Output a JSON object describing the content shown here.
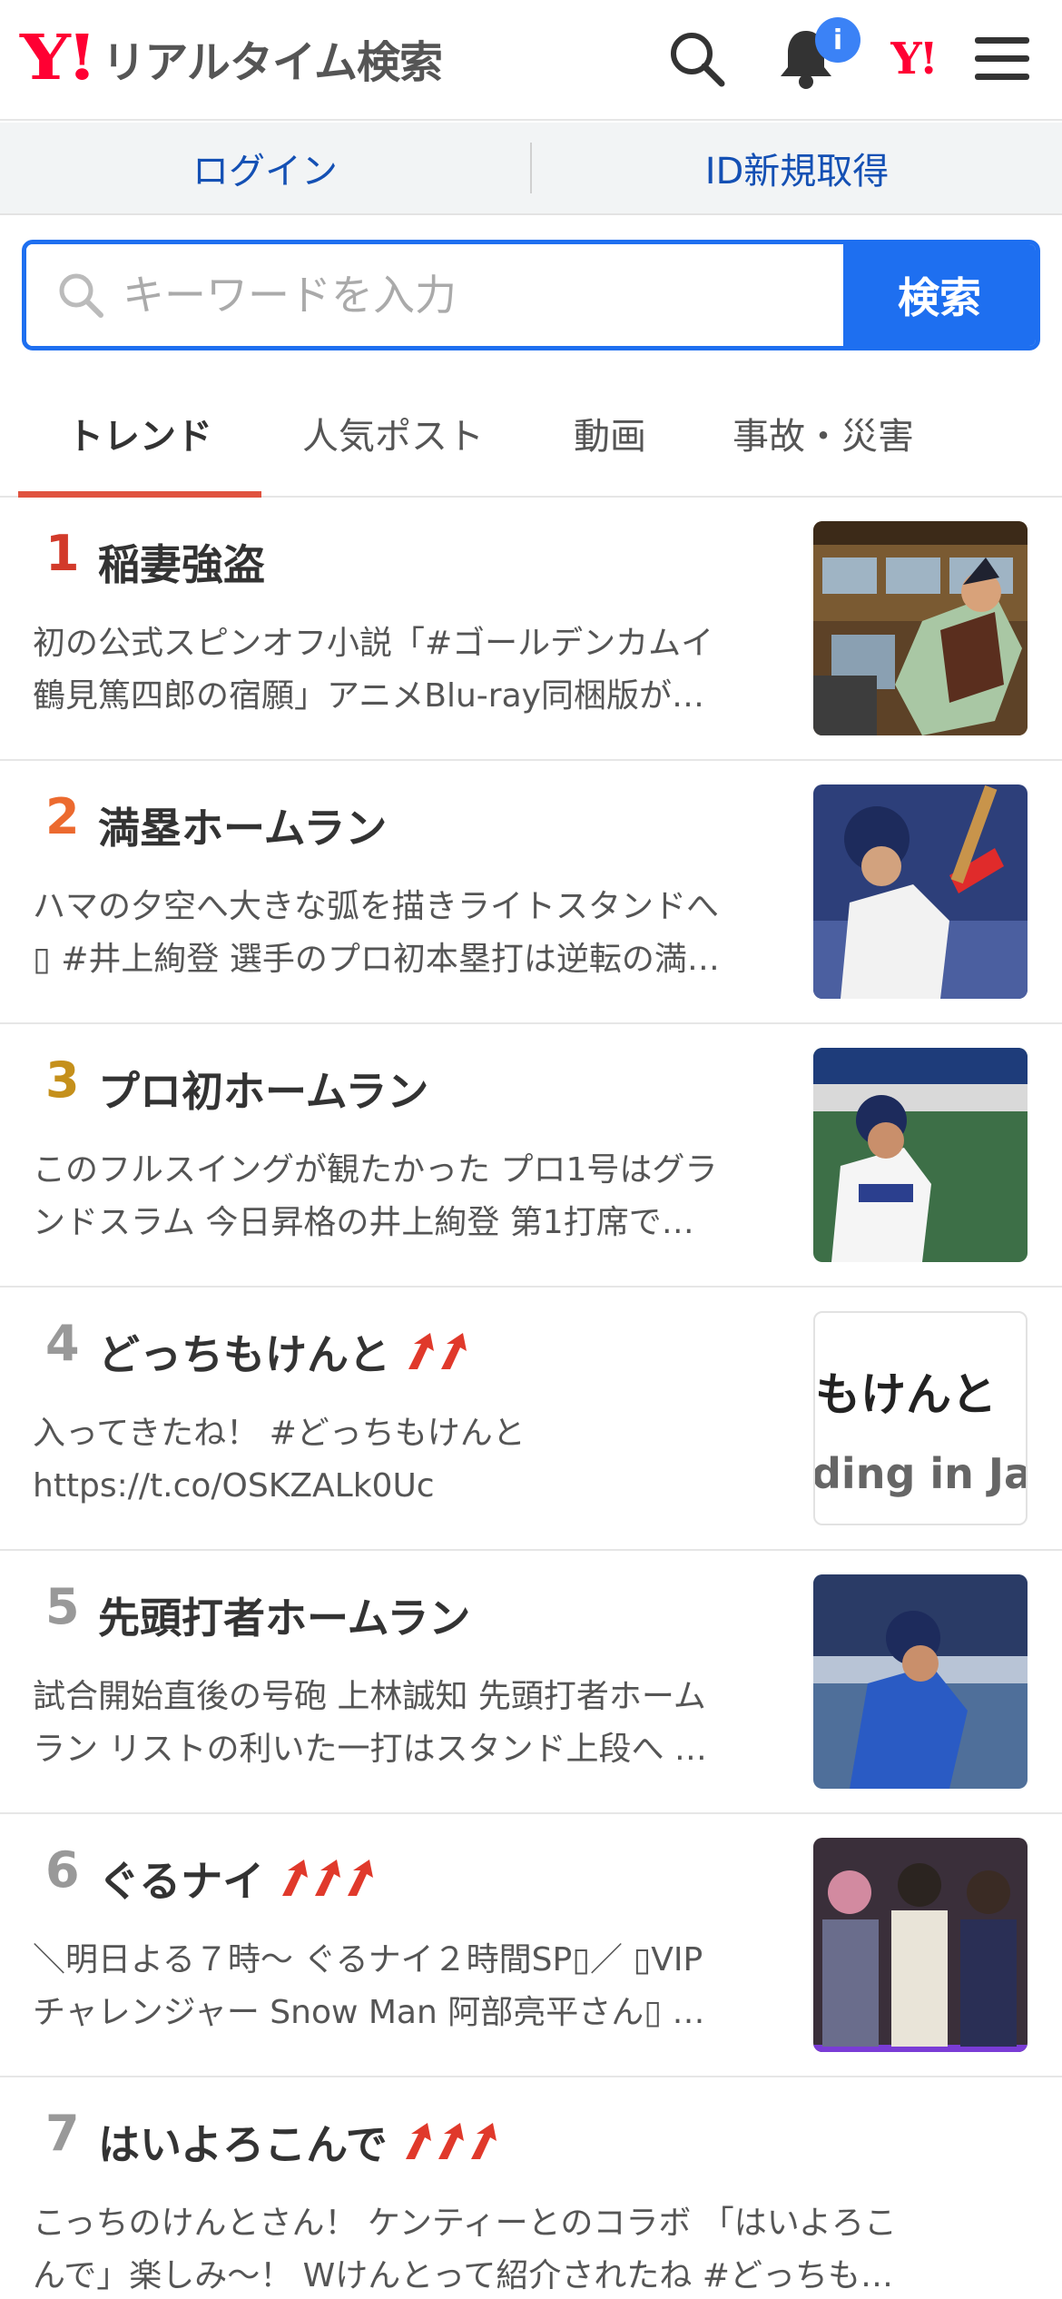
{
  "header": {
    "brand_logo": "Y!",
    "brand_title": "リアルタイム検索",
    "bell_badge": "i",
    "yahoo_logo": "Y!"
  },
  "account": {
    "login": "ログイン",
    "signup": "ID新規取得"
  },
  "search": {
    "placeholder": "キーワードを入力",
    "button": "検索"
  },
  "tabs": [
    "トレンド",
    "人気ポスト",
    "動画",
    "事故・災害"
  ],
  "trends": [
    {
      "rank": "1",
      "rank_color": "#d23a2a",
      "keyword": "稲妻強盗",
      "arrows": 0,
      "line1": "初の公式スピンオフ小説「#ゴールデンカムイ",
      "line2": "鶴見篤四郎の宿願」アニメBlu-ray同梱版が…",
      "thumb": "image"
    },
    {
      "rank": "2",
      "rank_color": "#ec6a2f",
      "keyword": "満塁ホームラン",
      "arrows": 0,
      "line1": "ハマの夕空へ大きな弧を描きライトスタンドへ",
      "line2": "▯ #井上絢登 選手のプロ初本塁打は逆転の満…",
      "thumb": "image"
    },
    {
      "rank": "3",
      "rank_color": "#c5901b",
      "keyword": "プロ初ホームラン",
      "arrows": 0,
      "line1": "このフルスイングが観たかった プロ1号はグラ",
      "line2": "ンドスラム 今日昇格の井上絢登 第1打席で…",
      "thumb": "image"
    },
    {
      "rank": "4",
      "rank_color": "#999999",
      "keyword": "どっちもけんと",
      "arrows": 2,
      "line1": "入ってきたね！ #どっちもけんと",
      "line2": "https://t.co/OSKZALk0Uc",
      "thumb": "text",
      "thumb_text1": "もけんと",
      "thumb_text2": "ding in Jap"
    },
    {
      "rank": "5",
      "rank_color": "#999999",
      "keyword": "先頭打者ホームラン",
      "arrows": 0,
      "line1": "試合開始直後の号砲 上林誠知 先頭打者ホーム",
      "line2": "ラン リストの利いた一打はスタンド上段へ …",
      "thumb": "image"
    },
    {
      "rank": "6",
      "rank_color": "#999999",
      "keyword": "ぐるナイ",
      "arrows": 3,
      "line1": "＼明日よる７時〜 ぐるナイ２時間SP▯／ ▯VIP",
      "line2": "チャレンジャー Snow Man 阿部亮平さん▯ …",
      "thumb": "image"
    },
    {
      "rank": "7",
      "rank_color": "#999999",
      "keyword": "はいよろこんで",
      "arrows": 3,
      "line1": "こっちのけんとさん！ ケンティーとのコラボ 「はいよろこ",
      "line2": "んで」楽しみ〜！ Wけんとって紹介されたね #どっちも…",
      "thumb": "none"
    }
  ],
  "colors": {
    "accent_blue": "#1e6ff0",
    "link_blue": "#1450b4",
    "active_tab_underline": "#e0523f",
    "trend_arrow_red": "#e0392b",
    "yahoo_red": "#ff0033"
  }
}
